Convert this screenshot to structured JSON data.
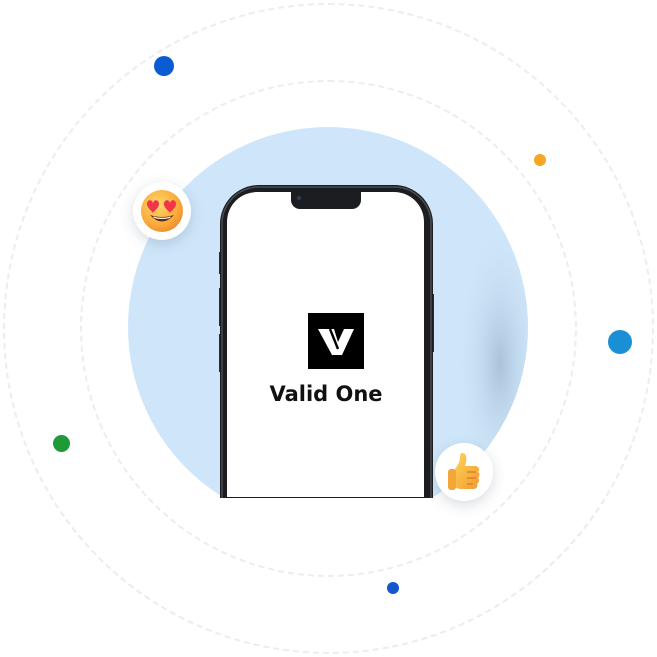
{
  "brand": {
    "app_name": "Valid One",
    "logo_icon": "valid-one-v-logo-icon"
  },
  "reactions": [
    {
      "icon": "heart-eyes-emoji-icon"
    },
    {
      "icon": "thumbs-up-emoji-icon"
    }
  ],
  "colors": {
    "background": "#ffffff",
    "ring": "#ececf1",
    "circle": "#cfe6fa",
    "phone_frame": "#1c1d20",
    "logo_bg": "#000000",
    "dot_blue": "#0b5bd3",
    "dot_yellow": "#f5a623",
    "dot_sky": "#1a8fd6",
    "dot_green": "#1e9a38",
    "dot_blue_small": "#1257cc"
  }
}
